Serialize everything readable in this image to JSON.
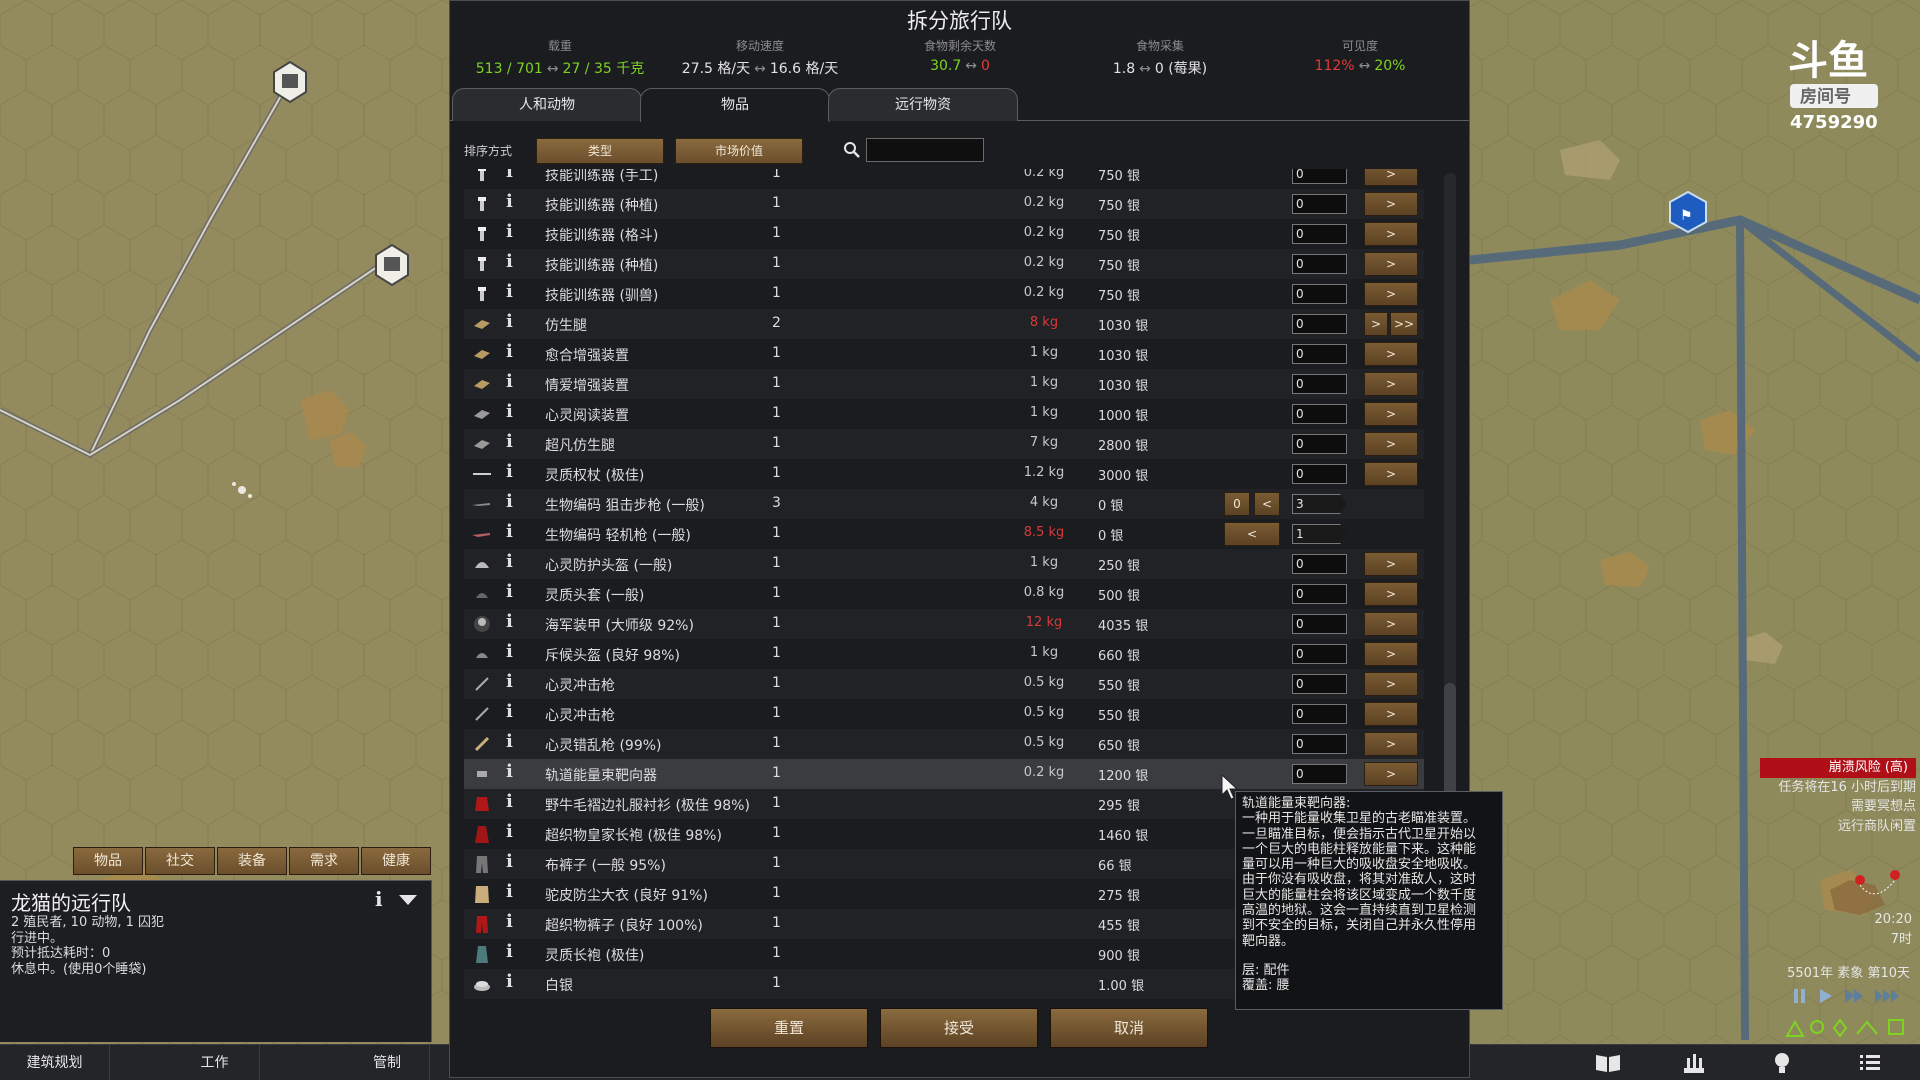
{
  "dialog": {
    "title": "拆分旅行队",
    "stats": {
      "mass": {
        "label": "载重",
        "v1": "513 / 701",
        "v2": "27 / 35 千克"
      },
      "speed": {
        "label": "移动速度",
        "v1": "27.5 格/天",
        "v2": "16.6 格/天"
      },
      "food_days": {
        "label": "食物剩余天数",
        "v1": "30.7",
        "v2": "0"
      },
      "forage": {
        "label": "食物采集",
        "v1": "1.8",
        "v2": "0 (莓果)"
      },
      "visibility": {
        "label": "可见度",
        "v1": "112%",
        "v2": "20%"
      }
    },
    "tabs": [
      "人和动物",
      "物品",
      "远行物资"
    ],
    "sort": {
      "label": "排序方式",
      "btn1": "类型",
      "btn2": "市场价值",
      "search_placeholder": ""
    },
    "rows": [
      {
        "name": "技能训练器 (手工)",
        "count": "1",
        "mass": "0.2 kg",
        "value": "750 银",
        "qty": "0",
        "over": false,
        "icon": "trainer",
        "mode": "single"
      },
      {
        "name": "技能训练器 (种植)",
        "count": "1",
        "mass": "0.2 kg",
        "value": "750 银",
        "qty": "0",
        "over": false,
        "icon": "trainer",
        "mode": "single"
      },
      {
        "name": "技能训练器 (格斗)",
        "count": "1",
        "mass": "0.2 kg",
        "value": "750 银",
        "qty": "0",
        "over": false,
        "icon": "trainer",
        "mode": "single"
      },
      {
        "name": "技能训练器 (种植)",
        "count": "1",
        "mass": "0.2 kg",
        "value": "750 银",
        "qty": "0",
        "over": false,
        "icon": "trainer",
        "mode": "single"
      },
      {
        "name": "技能训练器 (驯兽)",
        "count": "1",
        "mass": "0.2 kg",
        "value": "750 银",
        "qty": "0",
        "over": false,
        "icon": "trainer",
        "mode": "single"
      },
      {
        "name": "仿生腿",
        "count": "2",
        "mass": "8 kg",
        "value": "1030 银",
        "qty": "0",
        "over": true,
        "icon": "bionic",
        "mode": "double"
      },
      {
        "name": "愈合增强装置",
        "count": "1",
        "mass": "1 kg",
        "value": "1030 银",
        "qty": "0",
        "over": false,
        "icon": "bionic",
        "mode": "single"
      },
      {
        "name": "情爱增强装置",
        "count": "1",
        "mass": "1 kg",
        "value": "1030 银",
        "qty": "0",
        "over": false,
        "icon": "bionic",
        "mode": "single"
      },
      {
        "name": "心灵阅读装置",
        "count": "1",
        "mass": "1 kg",
        "value": "1000 银",
        "qty": "0",
        "over": false,
        "icon": "bionic-gray",
        "mode": "single"
      },
      {
        "name": "超凡仿生腿",
        "count": "1",
        "mass": "7 kg",
        "value": "2800 银",
        "qty": "0",
        "over": false,
        "icon": "bionic-gray",
        "mode": "single"
      },
      {
        "name": "灵质权杖 (极佳)",
        "count": "1",
        "mass": "1.2 kg",
        "value": "3000 银",
        "qty": "0",
        "over": false,
        "icon": "staff",
        "mode": "single"
      },
      {
        "name": "生物编码 狙击步枪 (一般)",
        "count": "3",
        "mass": "4 kg",
        "value": "0 银",
        "qty": "3",
        "over": false,
        "icon": "rifle",
        "mode": "left",
        "left_num": "0"
      },
      {
        "name": "生物编码 轻机枪 (一般)",
        "count": "1",
        "mass": "8.5 kg",
        "value": "0 银",
        "qty": "1",
        "over": true,
        "icon": "lmg",
        "mode": "leftwide"
      },
      {
        "name": "心灵防护头盔 (一般)",
        "count": "1",
        "mass": "1 kg",
        "value": "250 银",
        "qty": "0",
        "over": false,
        "icon": "helmet",
        "mode": "single"
      },
      {
        "name": "灵质头套 (一般)",
        "count": "1",
        "mass": "0.8 kg",
        "value": "500 银",
        "qty": "0",
        "over": false,
        "icon": "hood",
        "mode": "single"
      },
      {
        "name": "海军装甲 (大师级 92%)",
        "count": "1",
        "mass": "12 kg",
        "value": "4035 银",
        "qty": "0",
        "over": true,
        "icon": "armor",
        "mode": "single"
      },
      {
        "name": "斥候头盔 (良好 98%)",
        "count": "1",
        "mass": "1 kg",
        "value": "660 银",
        "qty": "0",
        "over": false,
        "icon": "helmet2",
        "mode": "single"
      },
      {
        "name": "心灵冲击枪",
        "count": "1",
        "mass": "0.5 kg",
        "value": "550 银",
        "qty": "0",
        "over": false,
        "icon": "lance",
        "mode": "single"
      },
      {
        "name": "心灵冲击枪",
        "count": "1",
        "mass": "0.5 kg",
        "value": "550 银",
        "qty": "0",
        "over": false,
        "icon": "lance",
        "mode": "single"
      },
      {
        "name": "心灵错乱枪 (99%)",
        "count": "1",
        "mass": "0.5 kg",
        "value": "650 银",
        "qty": "0",
        "over": false,
        "icon": "lance2",
        "mode": "single"
      },
      {
        "name": "轨道能量束靶向器",
        "count": "1",
        "mass": "0.2 kg",
        "value": "1200 银",
        "qty": "0",
        "over": false,
        "icon": "targeter",
        "mode": "single"
      },
      {
        "name": "野牛毛褶边礼服衬衫 (极佳 98%)",
        "count": "1",
        "mass": "",
        "value": "295 银",
        "qty": "0",
        "over": false,
        "icon": "shirt-red",
        "mode": "single"
      },
      {
        "name": "超织物皇家长袍 (极佳 98%)",
        "count": "1",
        "mass": "",
        "value": "1460 银",
        "qty": "0",
        "over": false,
        "icon": "robe-red",
        "mode": "single"
      },
      {
        "name": "布裤子 (一般 95%)",
        "count": "1",
        "mass": "",
        "value": "66 银",
        "qty": "0",
        "over": false,
        "icon": "pants",
        "mode": "single"
      },
      {
        "name": "驼皮防尘大衣 (良好 91%)",
        "count": "1",
        "mass": "",
        "value": "275 银",
        "qty": "0",
        "over": false,
        "icon": "coat",
        "mode": "single"
      },
      {
        "name": "超织物裤子 (良好 100%)",
        "count": "1",
        "mass": "",
        "value": "455 银",
        "qty": "0",
        "over": false,
        "icon": "pants-red",
        "mode": "single"
      },
      {
        "name": "灵质长袍 (极佳)",
        "count": "1",
        "mass": "",
        "value": "900 银",
        "qty": "0",
        "over": false,
        "icon": "robe-teal",
        "mode": "single"
      },
      {
        "name": "白银",
        "count": "1",
        "mass": "",
        "value": "1.00 银",
        "qty": "0",
        "over": false,
        "icon": "silver",
        "mode": "doubleM"
      }
    ],
    "buttons": {
      "reset": "重置",
      "accept": "接受",
      "cancel": "取消"
    },
    "arrows": {
      "right": ">",
      "right2": ">>",
      "left": "<",
      "max": ">M"
    },
    "tooltip": {
      "title": "轨道能量束靶向器:",
      "body": [
        "一种用于能量收集卫星的古老瞄准装置。",
        "一旦瞄准目标，便会指示古代卫星开始以",
        "一个巨大的电能柱释放能量下来。这种能",
        "量可以用一种巨大的吸收盘安全地吸收。",
        "由于你没有吸收盘，将其对准敌人，这时",
        "巨大的能量柱会将该区域变成一个数千度",
        "高温的地狱。这会一直持续直到卫星检测",
        "到不安全的目标，关闭自己并永久性停用",
        "靶向器。"
      ],
      "layer": "层: 配件",
      "cover": "覆盖: 腰"
    }
  },
  "left": {
    "tabs": [
      "物品",
      "社交",
      "装备",
      "需求",
      "健康"
    ],
    "caravan": {
      "title": "龙猫的远行队",
      "lines": [
        "2 殖民者, 10 动物, 1 囚犯",
        "行进中。",
        "预计抵达耗时：0",
        "休息中。(使用0个睡袋)"
      ]
    }
  },
  "bottombar": {
    "architect": "建筑规划",
    "work": "工作",
    "restrict": "管制"
  },
  "right": {
    "logo_text": "斗鱼",
    "room_label": "房间号",
    "room_number": "4759290",
    "alerts": [
      "崩溃风险 (高)",
      "任务将在16 小时后到期",
      "需要冥想点",
      "远行商队闲置"
    ],
    "time": "20:20",
    "hour": "7时",
    "date": "5501年 素象 第10天"
  },
  "colors": {
    "accent_red": "#b00f18",
    "green": "#7ed321",
    "red": "#e23b3b",
    "button_brown": "#7a5c34"
  }
}
